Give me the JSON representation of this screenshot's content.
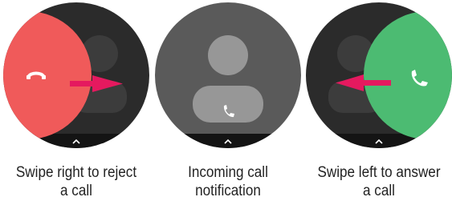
{
  "screens": [
    {
      "id": "reject",
      "background": "#2b2b2b",
      "action_color": "#f05a5a",
      "arrow_color": "#e5195f",
      "action_icon": "hang-up-icon",
      "swipe_direction": "right",
      "caption_line1": "Swipe right to reject",
      "caption_line2": "a call"
    },
    {
      "id": "incoming",
      "background": "#5a5a5a",
      "action_icon": "phone-icon",
      "caption_line1": "Incoming call",
      "caption_line2": "notification"
    },
    {
      "id": "answer",
      "background": "#2b2b2b",
      "action_color": "#4cbb72",
      "arrow_color": "#e5195f",
      "action_icon": "phone-icon",
      "swipe_direction": "left",
      "caption_line1": "Swipe left to answer",
      "caption_line2": "a call"
    }
  ],
  "icons": {
    "up_indicator": "chevron-up-icon",
    "caller": "avatar-placeholder-icon"
  }
}
